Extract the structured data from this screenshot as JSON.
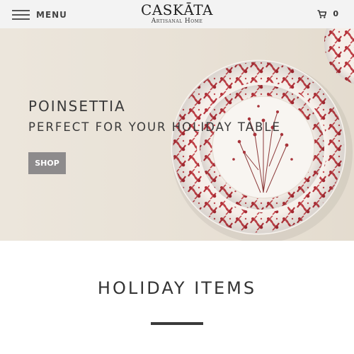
{
  "header": {
    "menu_label": "MENU",
    "menu_icon": "hamburger-icon",
    "logo_name": "CASKĀTA",
    "logo_tagline": "Artisanal Home",
    "cart_icon": "cart-icon",
    "cart_count": "0"
  },
  "hero": {
    "title": "POINSETTIA",
    "subtitle": "PERFECT FOR YOUR HOLIDAY TABLE",
    "button_label": "SHOP"
  },
  "section": {
    "title": "HOLIDAY ITEMS"
  },
  "colors": {
    "header_bg": "#f3f3f3",
    "hero_bg": "#e9e2d7",
    "plate_red": "#b5323a",
    "button_bg": "#8d8b8c",
    "divider": "#3a3a3a"
  }
}
